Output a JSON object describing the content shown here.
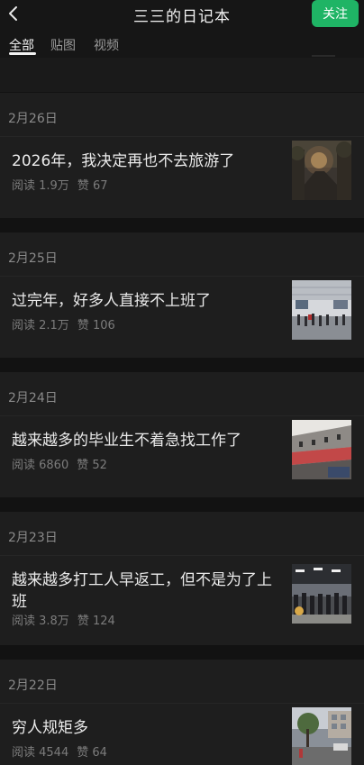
{
  "header": {
    "title": "三三的日记本",
    "follow_label": "关注"
  },
  "tabs": [
    "全部",
    "贴图",
    "视频"
  ],
  "articles": [
    {
      "date": "2月26日",
      "title": "2026年，我决定再也不去旅游了",
      "reads": "阅读 1.9万",
      "likes": "赞 67",
      "thumb": "night-road-photo"
    },
    {
      "date": "2月25日",
      "title": "过完年，好多人直接不上班了",
      "reads": "阅读 2.1万",
      "likes": "赞 106",
      "thumb": "station-crowd-photo"
    },
    {
      "date": "2月24日",
      "title": "越来越多的毕业生不着急找工作了",
      "reads": "阅读 6860",
      "likes": "赞 52",
      "thumb": "train-interior-photo"
    },
    {
      "date": "2月23日",
      "title": "越来越多打工人早返工，但不是为了上班",
      "reads": "阅读 3.8万",
      "likes": "赞 124",
      "thumb": "station-queue-photo"
    },
    {
      "date": "2月22日",
      "title": "穷人规矩多",
      "reads": "阅读 4544",
      "likes": "赞 64",
      "thumb": "street-scene-photo"
    }
  ]
}
